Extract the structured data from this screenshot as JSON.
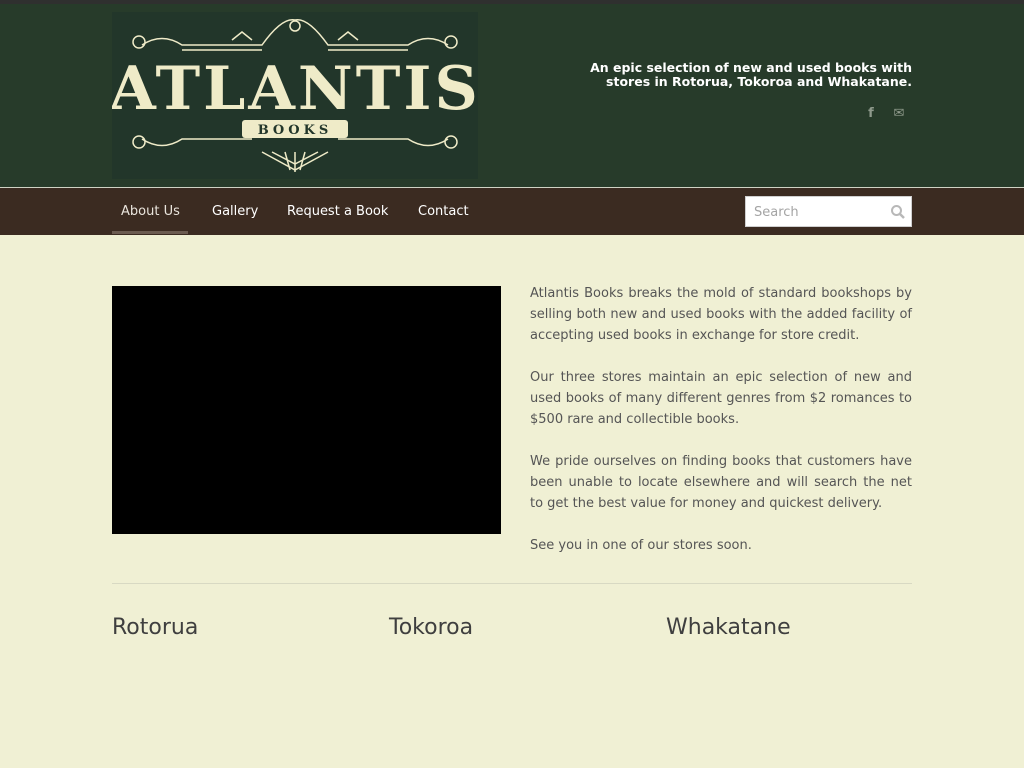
{
  "brand": {
    "logo_title": "ATLANTIS",
    "logo_subtitle": "BOOKS",
    "tagline_line1": "An epic selection of new and used books with",
    "tagline_line2": "stores in Rotorua, Tokoroa and Whakatane."
  },
  "social": {
    "facebook_glyph": "f",
    "email_glyph": "✉"
  },
  "nav": {
    "items": [
      "About Us",
      "Gallery",
      "Request a Book",
      "Contact"
    ],
    "active": "About Us"
  },
  "search": {
    "placeholder": "Search"
  },
  "content": {
    "paragraphs": [
      "Atlantis Books breaks the mold of standard bookshops by selling both new and used books with the added facility of accepting used books in exchange for store credit.",
      "Our three stores maintain an epic selection of new and used books of many different genres from $2 romances to $500 rare and collectible books.",
      "We pride ourselves on finding books that customers have been unable to locate elsewhere and will search the net to get the best value for money and quickest delivery.",
      "See you in one of our stores soon."
    ]
  },
  "stores": [
    "Rotorua",
    "Tokoroa",
    "Whakatane"
  ],
  "colors": {
    "header_bg": "#273b2a",
    "nav_bg": "#3b2b21",
    "page_bg": "#f0f0d4",
    "logo_ink": "#efebc8"
  }
}
